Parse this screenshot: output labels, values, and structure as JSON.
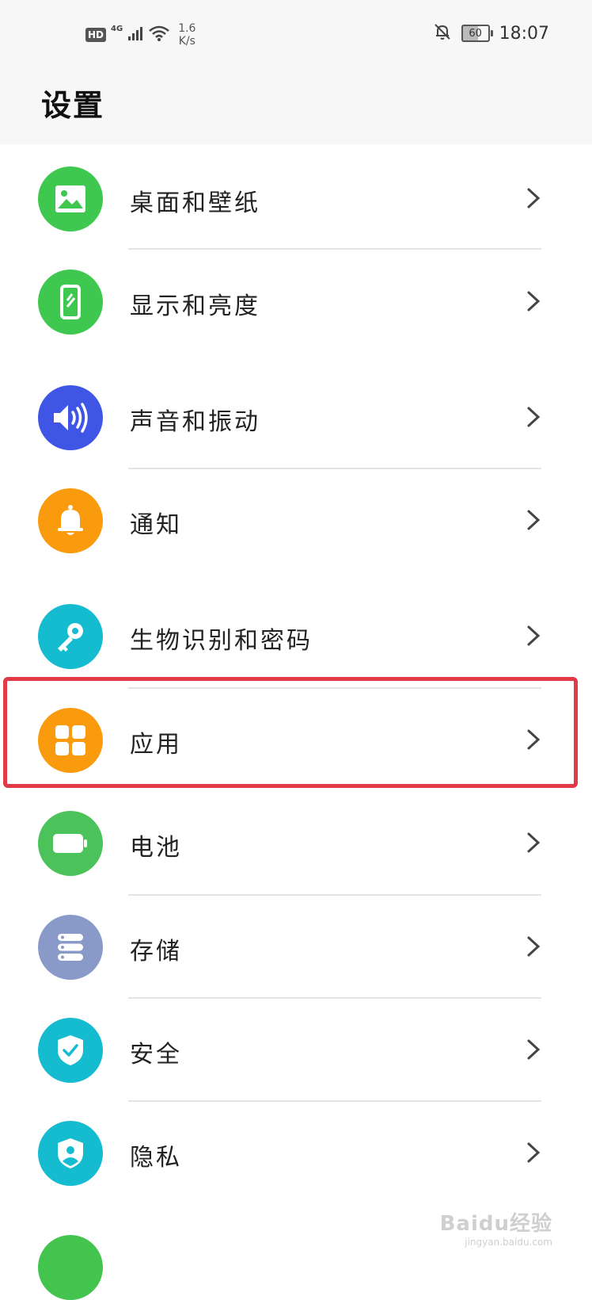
{
  "status_bar": {
    "hd_label": "HD",
    "network_type": "4G",
    "speed_value": "1.6",
    "speed_unit": "K/s",
    "battery_level": "60",
    "time": "18:07",
    "icons": [
      "signal-icon",
      "wifi-icon",
      "bell-off-icon",
      "battery-icon"
    ]
  },
  "header": {
    "title": "设置"
  },
  "items": [
    {
      "label": "桌面和壁纸",
      "icon": "wallpaper-icon",
      "color": "#3ec84f"
    },
    {
      "label": "显示和亮度",
      "icon": "display-icon",
      "color": "#3ec84f"
    },
    {
      "label": "声音和振动",
      "icon": "sound-icon",
      "color": "#3f55e6"
    },
    {
      "label": "通知",
      "icon": "bell-icon",
      "color": "#fa9a0d"
    },
    {
      "label": "生物识别和密码",
      "icon": "key-icon",
      "color": "#15bcd0"
    },
    {
      "label": "应用",
      "icon": "apps-icon",
      "color": "#fa9a0d"
    },
    {
      "label": "电池",
      "icon": "battery-icon",
      "color": "#4bc25a"
    },
    {
      "label": "存储",
      "icon": "storage-icon",
      "color": "#8a9ac8"
    },
    {
      "label": "安全",
      "icon": "shield-check-icon",
      "color": "#15bcd0"
    },
    {
      "label": "隐私",
      "icon": "privacy-icon",
      "color": "#15bcd0"
    }
  ],
  "annotation": {
    "highlight_color": "#e23a47"
  },
  "watermark": {
    "text": "Baidu经验",
    "sub": "jingyan.baidu.com"
  }
}
